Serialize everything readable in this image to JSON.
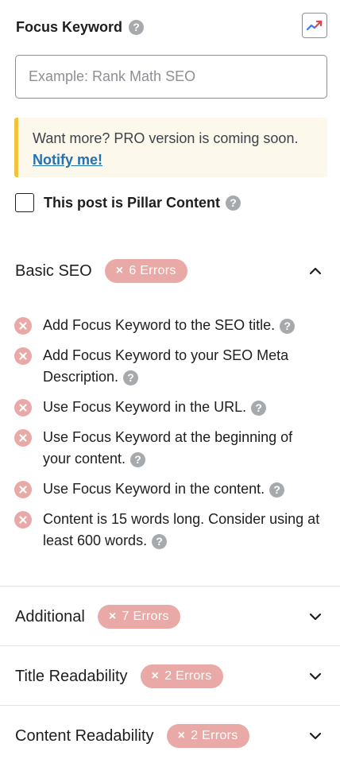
{
  "focus_keyword": {
    "title": "Focus Keyword",
    "help_icon": "question-icon",
    "trends_icon": "trend-chart-icon",
    "input_placeholder": "Example: Rank Math SEO",
    "input_value": ""
  },
  "notice": {
    "text": "Want more? PRO version is coming soon.",
    "link": "Notify me!",
    "accent_color": "#f0c33c"
  },
  "pillar": {
    "label": "This post is Pillar Content",
    "checked": false
  },
  "sections": {
    "basic": {
      "title": "Basic SEO",
      "badge_x": "×",
      "badge": "6 Errors",
      "expanded": true
    },
    "additional": {
      "title": "Additional",
      "badge_x": "×",
      "badge": "7 Errors",
      "expanded": false
    },
    "title_readability": {
      "title": "Title Readability",
      "badge_x": "×",
      "badge": "2 Errors",
      "expanded": false
    },
    "content_readability": {
      "title": "Content Readability",
      "badge_x": "×",
      "badge": "2 Errors",
      "expanded": false
    }
  },
  "basic_tests": [
    "Add Focus Keyword to the SEO title.",
    "Add Focus Keyword to your SEO Meta Description.",
    "Use Focus Keyword in the URL.",
    "Use Focus Keyword at the beginning of your content.",
    "Use Focus Keyword in the content.",
    "Content is 15 words long. Consider using at least 600 words."
  ],
  "colors": {
    "error_badge": "#e8a9a7",
    "link": "#2271b1",
    "help_icon": "#a7aaad"
  }
}
